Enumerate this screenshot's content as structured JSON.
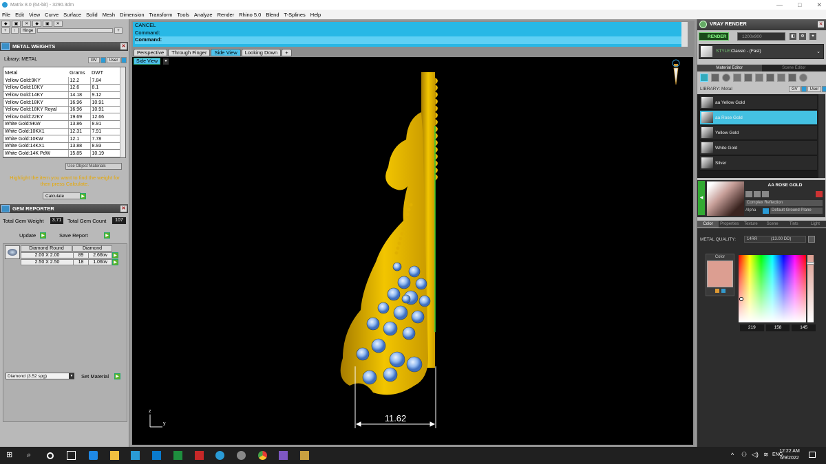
{
  "window": {
    "title": "Matrix 8.0 (64-bit) - 3290.3dm",
    "controls": [
      "—",
      "□",
      "✕"
    ]
  },
  "menu": [
    "File",
    "Edit",
    "View",
    "Curve",
    "Surface",
    "Solid",
    "Mesh",
    "Dimension",
    "Transform",
    "Tools",
    "Analyze",
    "Render",
    "Rhino 5.0",
    "Blend",
    "T-Splines",
    "Help"
  ],
  "toolbar": {
    "hinge_label": "Hinge"
  },
  "metal_weights": {
    "title": "METAL WEIGHTS",
    "library_label": "Library: METAL",
    "tag_gv": "GV",
    "tag_user": "User",
    "columns": [
      "Metal",
      "Grams",
      "DWT"
    ],
    "rows": [
      [
        "Yellow Gold:9KY",
        "12.2",
        "7.84"
      ],
      [
        "Yellow Gold:10KY",
        "12.6",
        "8.1"
      ],
      [
        "Yellow Gold:14KY",
        "14.18",
        "9.12"
      ],
      [
        "Yellow Gold:18KY",
        "16.96",
        "10.91"
      ],
      [
        "Yellow Gold:18KY Royal",
        "16.96",
        "10.91"
      ],
      [
        "Yellow Gold:22KY",
        "19.69",
        "12.66"
      ],
      [
        "White Gold:9KW",
        "13.86",
        "8.91"
      ],
      [
        "White Gold:10KX1",
        "12.31",
        "7.91"
      ],
      [
        "White Gold:10KW",
        "12.1",
        "7.78"
      ],
      [
        "White Gold:14KX1",
        "13.88",
        "8.93"
      ],
      [
        "White Gold:14K PdW",
        "15.85",
        "10.19"
      ]
    ],
    "use_object_materials": "Use Object Materials",
    "hint": "Highlight the item you want to find the weight for then press Calculate.",
    "calculate_label": "Calculate"
  },
  "gem_reporter": {
    "title": "GEM REPORTER",
    "total_weight_label": "Total Gem Weight",
    "total_weight": "3.71",
    "total_count_label": "Total Gem Count",
    "total_count": "107",
    "update_label": "Update",
    "save_label": "Save Report",
    "gem_name": "Diamond Round",
    "gem_type": "Diamond",
    "rows": [
      [
        "2.00 X 2.00",
        "89",
        "2.66tw"
      ],
      [
        "2.50 X 2.50",
        "18",
        "1.06tw"
      ]
    ],
    "material_select": "Diamond    (3.52 spg)",
    "set_material_label": "Set Material"
  },
  "command": {
    "line1": "CANCEL",
    "line2": "Command:",
    "line3": "Command:"
  },
  "viewport_tabs": [
    "Perspective",
    "Through Finger",
    "Side View",
    "Looking Down",
    "+"
  ],
  "active_tab": "Side View",
  "viewport_label": "Side View",
  "dimension": "11.62",
  "axes": {
    "z": "z",
    "y": "y"
  },
  "vray": {
    "title": "VRAY RENDER",
    "render_label": "RENDER",
    "resolution": "1200x900",
    "style_prefix": "STYLE:",
    "style": "Classic - (Fast)",
    "tabs": [
      "Material Editor",
      "Scene Editor"
    ],
    "library_label": "LIBRARY: Metal",
    "tag_gv": "GV",
    "tag_user": "User",
    "materials": [
      "aa Yellow Gold",
      "aa Rose Gold",
      "Yellow Gold",
      "White Gold",
      "Silver"
    ],
    "selected_material": "AA ROSE GOLD",
    "reflection": "Complex Reflection",
    "alpha_label": "Alpha",
    "ground": "Default Ground Plane",
    "prop_tabs": [
      "Color",
      "Properties",
      "Texture",
      "Scene",
      "Tints",
      "Light"
    ],
    "metal_quality_label": "METAL QUALITY:",
    "metal_quality": "14RR",
    "metal_quality_sub": "(13.00 DD)",
    "color_label": "Color",
    "swatch_color": "#dc9e91",
    "rgb": [
      "219",
      "158",
      "145"
    ]
  },
  "taskbar": {
    "lang": "ENG",
    "time": "12:22 AM",
    "date": "6/9/2022"
  },
  "colors": {
    "accent": "#4ec4ee",
    "gold": "#e6b800",
    "gem": "#8fb8f0"
  }
}
